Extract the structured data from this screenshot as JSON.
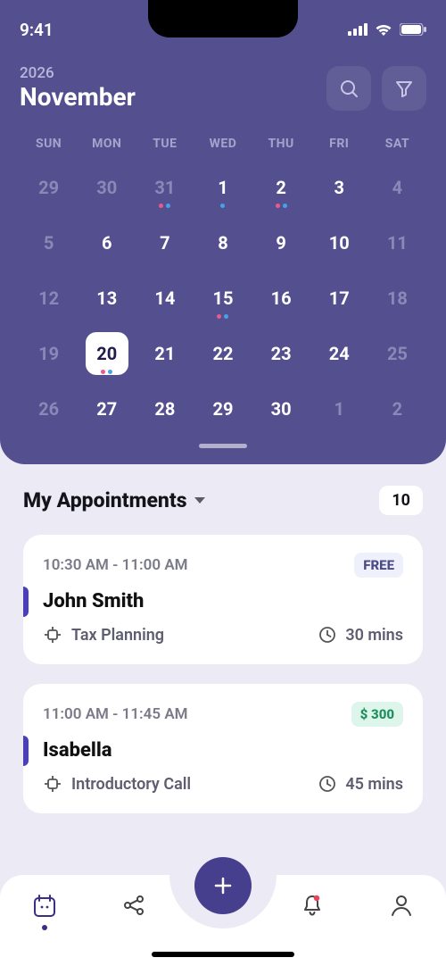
{
  "status": {
    "time": "9:41"
  },
  "header": {
    "year": "2026",
    "month": "November"
  },
  "weekdays": [
    "SUN",
    "MON",
    "TUE",
    "WED",
    "THU",
    "FRI",
    "SAT"
  ],
  "calendar": {
    "weeks": [
      [
        {
          "n": "29",
          "out": true
        },
        {
          "n": "30",
          "out": true
        },
        {
          "n": "31",
          "out": true,
          "dots": [
            "pink",
            "blue"
          ]
        },
        {
          "n": "1",
          "dots": [
            "blue"
          ]
        },
        {
          "n": "2",
          "dots": [
            "pink",
            "blue"
          ]
        },
        {
          "n": "3"
        },
        {
          "n": "4",
          "out": true
        }
      ],
      [
        {
          "n": "5",
          "out": true
        },
        {
          "n": "6"
        },
        {
          "n": "7"
        },
        {
          "n": "8"
        },
        {
          "n": "9"
        },
        {
          "n": "10"
        },
        {
          "n": "11",
          "out": true
        }
      ],
      [
        {
          "n": "12",
          "out": true
        },
        {
          "n": "13"
        },
        {
          "n": "14"
        },
        {
          "n": "15",
          "dots": [
            "pink",
            "blue"
          ]
        },
        {
          "n": "16"
        },
        {
          "n": "17"
        },
        {
          "n": "18",
          "out": true
        }
      ],
      [
        {
          "n": "19",
          "out": true
        },
        {
          "n": "20",
          "selected": true,
          "dots": [
            "pink",
            "blue"
          ]
        },
        {
          "n": "21"
        },
        {
          "n": "22"
        },
        {
          "n": "23"
        },
        {
          "n": "24"
        },
        {
          "n": "25",
          "out": true
        }
      ],
      [
        {
          "n": "26",
          "out": true
        },
        {
          "n": "27"
        },
        {
          "n": "28"
        },
        {
          "n": "29"
        },
        {
          "n": "30"
        },
        {
          "n": "1",
          "out": true
        },
        {
          "n": "2",
          "out": true
        }
      ]
    ]
  },
  "appointments": {
    "title": "My Appointments",
    "count": "10",
    "items": [
      {
        "time": "10:30 AM - 11:00 AM",
        "price": "FREE",
        "price_kind": "free",
        "name": "John Smith",
        "category": "Tax Planning",
        "duration": "30 mins"
      },
      {
        "time": "11:00 AM - 11:45 AM",
        "price": "$ 300",
        "price_kind": "paid",
        "name": "Isabella",
        "category": "Introductory Call",
        "duration": "45 mins"
      }
    ]
  }
}
